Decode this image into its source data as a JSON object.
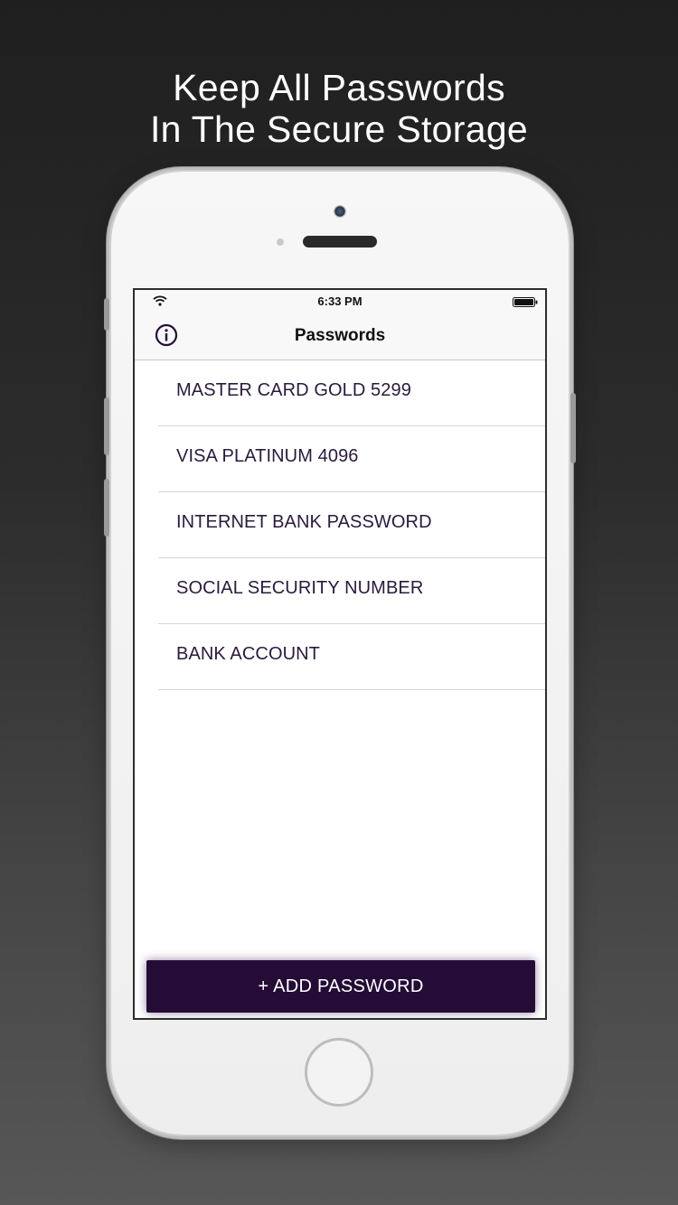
{
  "headline": {
    "line1": "Keep All Passwords",
    "line2": "In The Secure Storage"
  },
  "status_bar": {
    "time": "6:33 PM",
    "wifi_icon": "wifi-icon",
    "battery_icon": "battery-icon"
  },
  "navbar": {
    "title": "Passwords",
    "info_icon": "info-icon"
  },
  "passwords": [
    {
      "label": "MASTER CARD GOLD 5299"
    },
    {
      "label": "VISA PLATINUM 4096"
    },
    {
      "label": "INTERNET BANK PASSWORD"
    },
    {
      "label": "SOCIAL SECURITY NUMBER"
    },
    {
      "label": "BANK ACCOUNT"
    }
  ],
  "add_button": {
    "label": "+ ADD PASSWORD"
  },
  "colors": {
    "accent": "#250c36",
    "item_text": "#2b1a3c"
  }
}
